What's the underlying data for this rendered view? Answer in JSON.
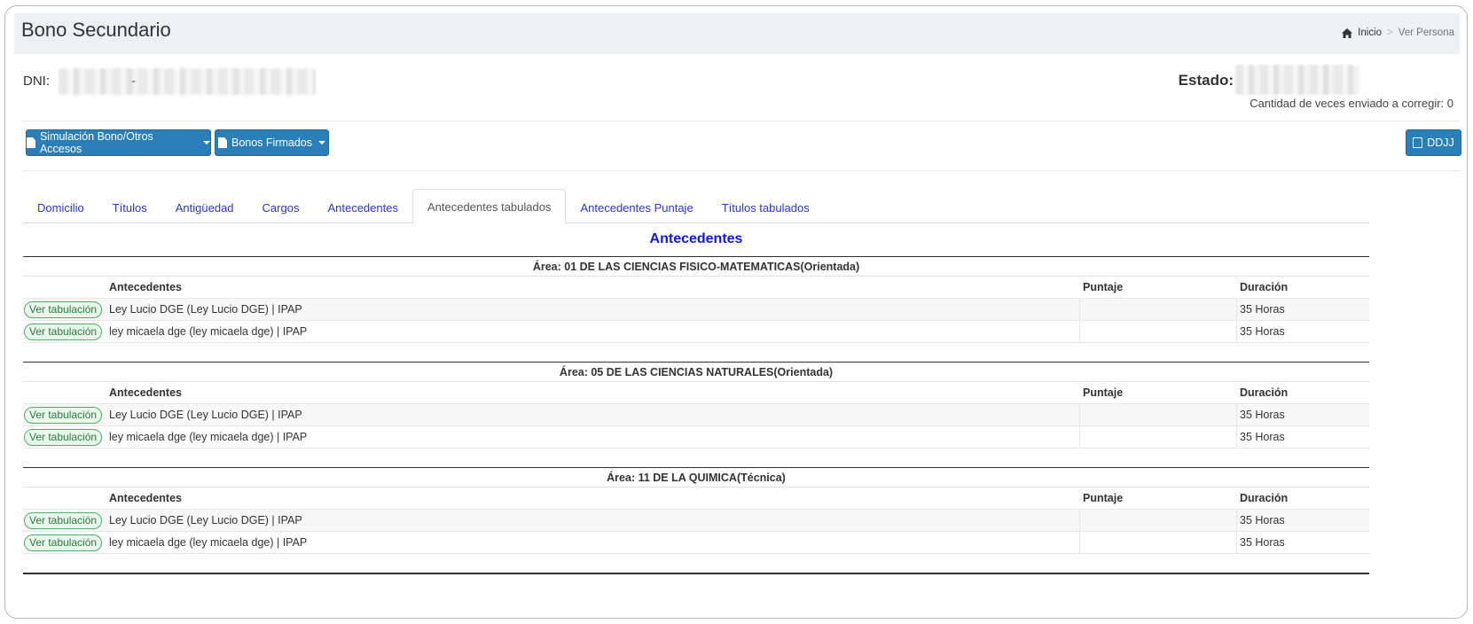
{
  "header": {
    "title": "Bono Secundario",
    "breadcrumb": {
      "home": "Inicio",
      "separator": ">",
      "current": "Ver Persona"
    }
  },
  "info": {
    "dni_label": "DNI:",
    "dni_separator": "-",
    "estado_label": "Estado:",
    "cantidad_text": "Cantidad de veces enviado a corregir: 0"
  },
  "toolbar": {
    "sim_label": "Simulación Bono/Otros Accesos",
    "bonos_label": "Bonos Firmados",
    "ddjj_label": "DDJJ"
  },
  "tabs": [
    {
      "label": "Domicilio"
    },
    {
      "label": "Títulos"
    },
    {
      "label": "Antigüedad"
    },
    {
      "label": "Cargos"
    },
    {
      "label": "Antecedentes"
    },
    {
      "label": "Antecedentes tabulados",
      "active": true
    },
    {
      "label": "Antecedentes Puntaje"
    },
    {
      "label": "Títulos tabulados"
    }
  ],
  "section": {
    "title": "Antecedentes"
  },
  "columns": {
    "antecedentes": "Antecedentes",
    "puntaje": "Puntaje",
    "duracion": "Duración"
  },
  "action_label": "Ver tabulación",
  "areas": [
    {
      "title": "Área: 01 DE LAS CIENCIAS FISICO-MATEMATICAS(Orientada)",
      "rows": [
        {
          "antecedente": "Ley Lucio DGE (Ley Lucio DGE) | IPAP",
          "puntaje": "",
          "duracion": "35 Horas"
        },
        {
          "antecedente": "ley micaela dge (ley micaela dge) | IPAP",
          "puntaje": "",
          "duracion": "35 Horas"
        }
      ]
    },
    {
      "title": "Área: 05 DE LAS CIENCIAS NATURALES(Orientada)",
      "rows": [
        {
          "antecedente": "Ley Lucio DGE (Ley Lucio DGE) | IPAP",
          "puntaje": "",
          "duracion": "35 Horas"
        },
        {
          "antecedente": "ley micaela dge (ley micaela dge) | IPAP",
          "puntaje": "",
          "duracion": "35 Horas"
        }
      ]
    },
    {
      "title": "Área: 11 DE LA QUIMICA(Técnica)",
      "rows": [
        {
          "antecedente": "Ley Lucio DGE (Ley Lucio DGE) | IPAP",
          "puntaje": "",
          "duracion": "35 Horas"
        },
        {
          "antecedente": "ley micaela dge (ley micaela dge) | IPAP",
          "puntaje": "",
          "duracion": "35 Horas"
        }
      ]
    }
  ],
  "colors": {
    "primary_button": "#2b7fb8",
    "tab_link": "#2b34d6",
    "section_title": "#1414ee",
    "pill_border": "#4caf6a"
  },
  "icons": {
    "home": "home-icon",
    "document": "document-icon",
    "pdf": "pdf-icon",
    "caret": "caret-down-icon"
  }
}
